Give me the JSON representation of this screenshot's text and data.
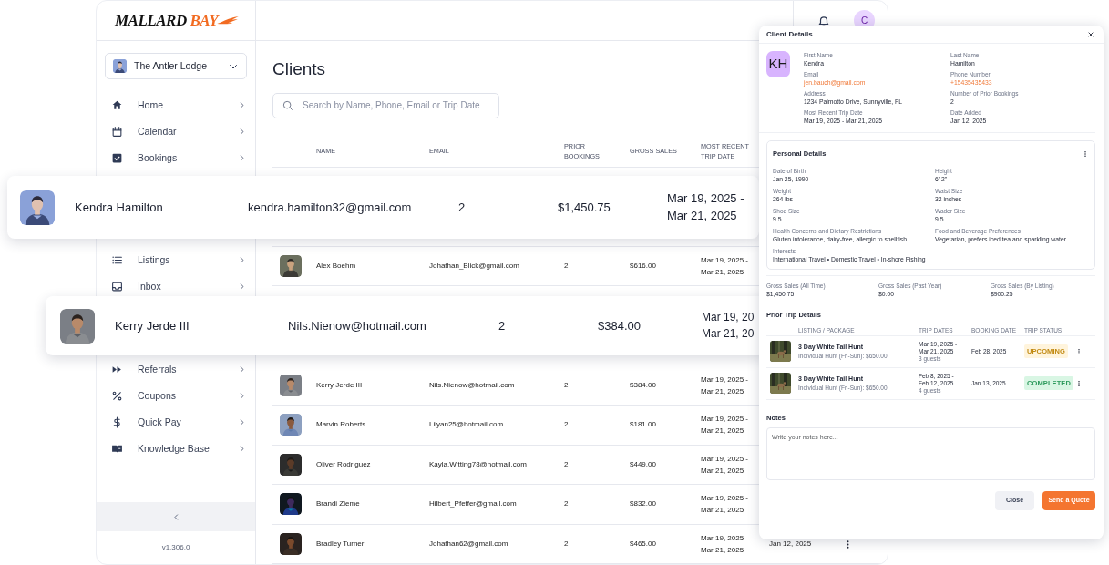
{
  "logo": {
    "dark": "MALLARD",
    "accent": "BAY"
  },
  "header": {
    "avatar_initial": "C"
  },
  "sidebar": {
    "account": "The Antler Lodge",
    "items": [
      {
        "label": "Home"
      },
      {
        "label": "Calendar"
      },
      {
        "label": "Bookings"
      },
      {
        "label": "Listings"
      },
      {
        "label": "Inbox"
      },
      {
        "label": "Referrals"
      },
      {
        "label": "Coupons"
      },
      {
        "label": "Quick Pay"
      },
      {
        "label": "Knowledge Base"
      }
    ],
    "version": "v1.306.0"
  },
  "page": {
    "title": "Clients",
    "search": {
      "placeholder": "Search by Name, Phone, Email or Trip Date"
    }
  },
  "table": {
    "columns": [
      "NAME",
      "EMAIL",
      "PRIOR\nBOOKINGS",
      "GROSS SALES",
      "MOST RECENT\nTRIP DATE"
    ],
    "rows": [
      {
        "name": "Alex Boehm",
        "email": "Johathan_Blick@gmail.com",
        "prior_bookings": "2",
        "gross_sales": "$616.00",
        "trip_dates": "Mar 19, 2025 -\nMar 21, 2025"
      },
      {
        "name": "Kerry Jerde III",
        "email": "Nils.Nienow@hotmail.com",
        "prior_bookings": "2",
        "gross_sales": "$384.00",
        "trip_dates": "Mar 19, 2025 -\nMar 21, 2025"
      },
      {
        "name": "Marvin Roberts",
        "email": "Lilyan25@hotmail.com",
        "prior_bookings": "2",
        "gross_sales": "$181.00",
        "trip_dates": "Mar 19, 2025 -\nMar 21, 2025"
      },
      {
        "name": "Oliver Rodriguez",
        "email": "Kayla.Witting78@hotmail.com",
        "prior_bookings": "2",
        "gross_sales": "$449.00",
        "trip_dates": "Mar 19, 2025 -\nMar 21, 2025"
      },
      {
        "name": "Brandi Zieme",
        "email": "Hilbert_Pfeffer@gmail.com",
        "prior_bookings": "2",
        "gross_sales": "$832.00",
        "trip_dates": "Mar 19, 2025 -\nMar 21, 2025"
      },
      {
        "name": "Bradley Turner",
        "email": "Johathan62@gmail.com",
        "prior_bookings": "2",
        "gross_sales": "$465.00",
        "trip_dates": "Mar 19, 2025 -\nMar 21, 2025",
        "date_added": "Jan 12, 2025"
      }
    ]
  },
  "highlight_cards": [
    {
      "name": "Kendra Hamilton",
      "email": "kendra.hamilton32@gmail.com",
      "prior_bookings": "2",
      "gross_sales": "$1,450.75",
      "trip_dates": "Mar 19, 2025 -\nMar 21, 2025"
    },
    {
      "name": "Kerry Jerde III",
      "email": "Nils.Nienow@hotmail.com",
      "prior_bookings": "2",
      "gross_sales": "$384.00",
      "trip_dates": "Mar 19, 20\nMar 21, 20"
    }
  ],
  "client_details": {
    "title": "Client Details",
    "initials": "KH",
    "fields": [
      {
        "label": "First Name",
        "value": "Kendra",
        "kind": "text"
      },
      {
        "label": "Last Name",
        "value": "Hamilton",
        "kind": "text"
      },
      {
        "label": "Email",
        "value": "jen.bauch@gmail.com",
        "kind": "link"
      },
      {
        "label": "Phone Number",
        "value": "+15435435433",
        "kind": "link"
      },
      {
        "label": "Address",
        "value": "1234 Palmotto Drive, Sunnyville, FL",
        "kind": "text"
      },
      {
        "label": "Number of Prior Bookings",
        "value": "2",
        "kind": "text"
      },
      {
        "label": "Most Recent Trip Date",
        "value": "Mar 19, 2025 - Mar 21, 2025",
        "kind": "text"
      },
      {
        "label": "Date Added",
        "value": "Jan 12, 2025",
        "kind": "text"
      }
    ],
    "personal": {
      "title": "Personal Details",
      "fields": [
        {
          "label": "Date of Birth",
          "value": "Jan 25, 1990"
        },
        {
          "label": "Height",
          "value": "6' 2\""
        },
        {
          "label": "Weight",
          "value": "264 lbs"
        },
        {
          "label": "Waist Size",
          "value": "32 inches"
        },
        {
          "label": "Shoe Size",
          "value": "9.5"
        },
        {
          "label": "Wader Size",
          "value": "9.5"
        },
        {
          "label": "Health Concerns and Dietary Restrictions",
          "value": "Gluten intolerance, dairy-free, allergic to shellfish."
        },
        {
          "label": "Food and Beverage Preferences",
          "value": "Vegetarian, prefers iced tea and sparkling water."
        },
        {
          "label": "Interests",
          "value": "International Travel • Domestic Travel • In-shore Fishing"
        }
      ]
    },
    "sales": [
      {
        "label": "Gross Sales (All Time)",
        "value": "$1,450.75"
      },
      {
        "label": "Gross Sales (Past Year)",
        "value": "$0.00"
      },
      {
        "label": "Gross Sales (By Listing)",
        "value": "$900.25"
      }
    ],
    "trips": {
      "title": "Prior Trip Details",
      "columns": [
        "LISTING / PACKAGE",
        "TRIP DATES",
        "BOOKING DATE",
        "TRIP STATUS"
      ],
      "rows": [
        {
          "title": "3 Day White Tail Hunt",
          "package": "Individual Hunt (Fri-Sun): $650.00",
          "dates": "Mar 19, 2025 -\nMar 21, 2025",
          "guests": "3 guests",
          "booking_date": "Feb 28, 2025",
          "status": "UPCOMING",
          "kind": "upcoming"
        },
        {
          "title": "3 Day White Tail Hunt",
          "package": "Individual Hunt (Fri-Sun): $650.00",
          "dates": "Feb 8, 2025 -\nFeb 12, 2025",
          "guests": "4 guests",
          "booking_date": "Jan 13, 2025",
          "status": "COMPLETED",
          "kind": "completed"
        }
      ]
    },
    "notes": {
      "title": "Notes",
      "placeholder": "Write your notes here..."
    },
    "buttons": [
      {
        "label": "Close",
        "kind": "secondary"
      },
      {
        "label": "Send a Quote",
        "kind": "primary"
      }
    ]
  }
}
